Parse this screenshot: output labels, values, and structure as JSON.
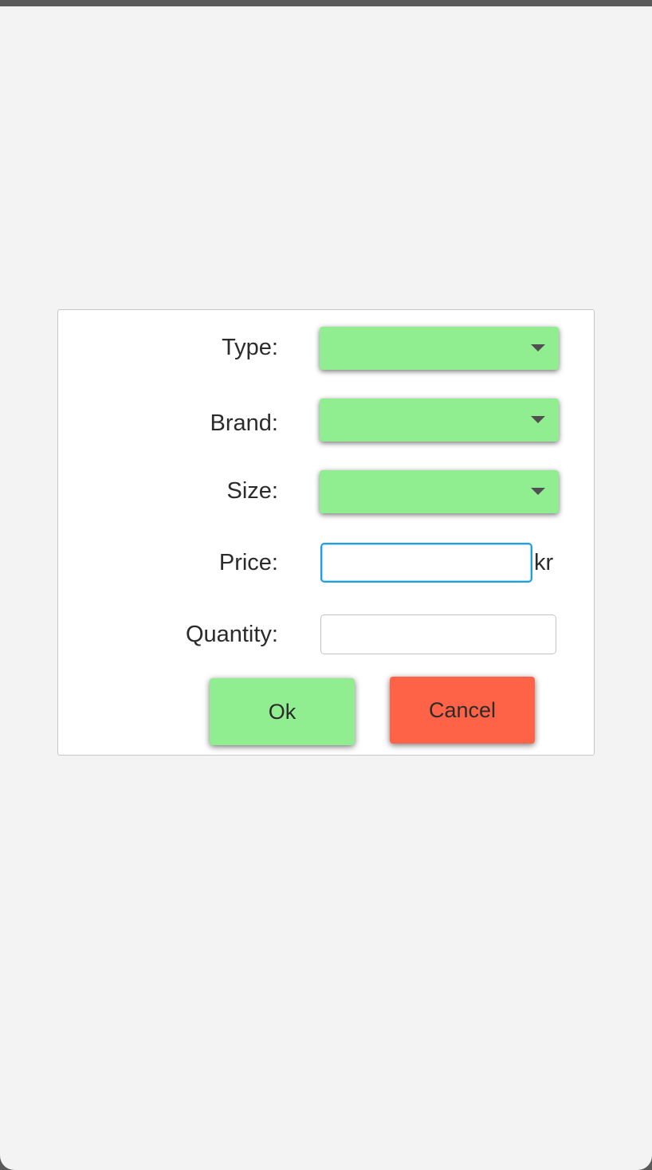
{
  "form": {
    "type": {
      "label": "Type:",
      "value": ""
    },
    "brand": {
      "label": "Brand:",
      "value": ""
    },
    "size": {
      "label": "Size:",
      "value": ""
    },
    "price": {
      "label": "Price:",
      "value": "",
      "unit": "kr"
    },
    "quantity": {
      "label": "Quantity:",
      "value": ""
    }
  },
  "buttons": {
    "ok_label": "Ok",
    "cancel_label": "Cancel"
  },
  "colors": {
    "accent_green": "#90ee90",
    "cancel_red": "#ff6347",
    "focus_blue": "#1ea0dd"
  },
  "icons": {
    "dropdown": "chevron-down-icon"
  }
}
